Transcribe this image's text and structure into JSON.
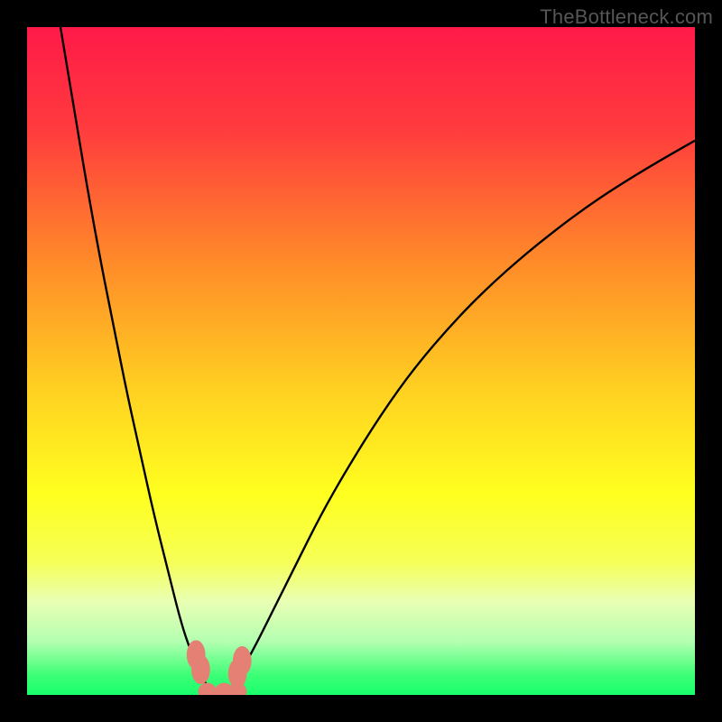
{
  "watermark": "TheBottleneck.com",
  "chart_data": {
    "type": "line",
    "title": "",
    "xlabel": "",
    "ylabel": "",
    "xlim": [
      0,
      100
    ],
    "ylim": [
      0,
      100
    ],
    "background_gradient": {
      "stops": [
        {
          "offset": 0,
          "color": "#ff1a48"
        },
        {
          "offset": 15,
          "color": "#ff3a3e"
        },
        {
          "offset": 35,
          "color": "#ff8a29"
        },
        {
          "offset": 55,
          "color": "#ffd321"
        },
        {
          "offset": 70,
          "color": "#ffff1f"
        },
        {
          "offset": 80,
          "color": "#f6ff56"
        },
        {
          "offset": 86,
          "color": "#e9ffb4"
        },
        {
          "offset": 92,
          "color": "#b4ffb1"
        },
        {
          "offset": 97,
          "color": "#3dff77"
        },
        {
          "offset": 100,
          "color": "#19ff6c"
        }
      ]
    },
    "series": [
      {
        "name": "left-curve",
        "x": [
          5,
          7,
          9,
          11,
          13,
          15,
          17,
          19,
          21,
          23,
          24.5,
          26,
          27.5
        ],
        "y": [
          100,
          88,
          76,
          65,
          55,
          45,
          36,
          27,
          19,
          11,
          6.5,
          3.5,
          0
        ]
      },
      {
        "name": "right-curve",
        "x": [
          30,
          32,
          34,
          37,
          40,
          44,
          48,
          53,
          58,
          64,
          70,
          77,
          85,
          93,
          100
        ],
        "y": [
          0,
          3.5,
          7,
          13,
          19,
          27,
          34,
          42,
          49,
          56,
          62,
          68,
          74,
          79,
          83
        ]
      }
    ],
    "markers": [
      {
        "name": "marker-a",
        "cx": 25.3,
        "cy": 6.0,
        "rx": 1.4,
        "ry": 2.2,
        "fill": "#e58074"
      },
      {
        "name": "marker-b",
        "cx": 26.0,
        "cy": 3.8,
        "rx": 1.4,
        "ry": 2.2,
        "fill": "#e58074"
      },
      {
        "name": "marker-c",
        "cx": 31.5,
        "cy": 3.2,
        "rx": 1.4,
        "ry": 2.2,
        "fill": "#e58074"
      },
      {
        "name": "marker-d",
        "cx": 32.2,
        "cy": 5.1,
        "rx": 1.4,
        "ry": 2.2,
        "fill": "#e58074"
      },
      {
        "name": "marker-e",
        "cx": 27.0,
        "cy": 0.5,
        "rx": 1.4,
        "ry": 1.3,
        "fill": "#e58074"
      },
      {
        "name": "marker-f",
        "cx": 29.5,
        "cy": 0.5,
        "rx": 1.4,
        "ry": 1.3,
        "fill": "#e58074"
      },
      {
        "name": "marker-g",
        "cx": 31.5,
        "cy": 0.5,
        "rx": 1.4,
        "ry": 1.3,
        "fill": "#e58074"
      }
    ]
  }
}
